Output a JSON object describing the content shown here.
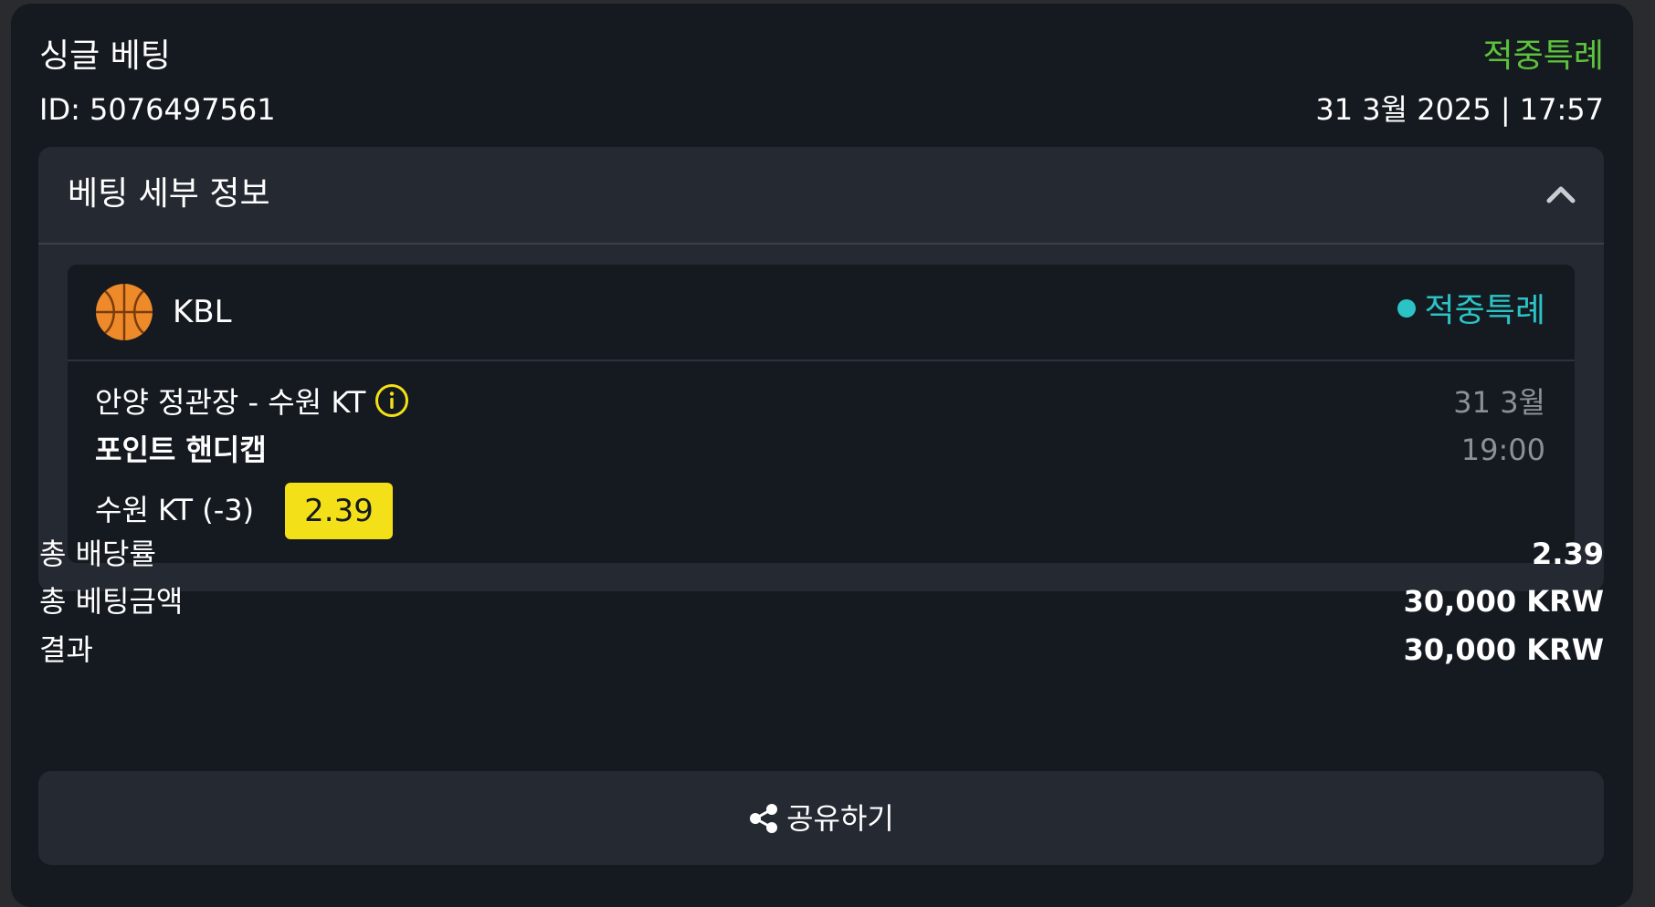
{
  "header": {
    "title": "싱글 베팅",
    "status": "적중특례",
    "id_text": "ID: 5076497561",
    "placed_at": "31 3월 2025 | 17:57"
  },
  "details": {
    "title": "베팅 세부 정보",
    "selection": {
      "league": "KBL",
      "status": "적중특례",
      "match": "안양 정관장 - 수원 KT",
      "date": "31 3월",
      "time": "19:00",
      "market": "포인트 핸디캡",
      "pick": "수원 KT (-3)",
      "odds": "2.39"
    }
  },
  "summary": [
    {
      "label": "총 배당률",
      "value": "2.39"
    },
    {
      "label": "총 베팅금액",
      "value": "30,000 KRW"
    },
    {
      "label": "결과",
      "value": "30,000 KRW"
    }
  ],
  "share": {
    "label": "공유하기"
  },
  "colors": {
    "card_bg": "#151a21",
    "panel_bg": "#252932",
    "status_green": "#5dc23c",
    "status_teal": "#2bc3c6",
    "odds_yellow": "#f4e018",
    "muted_text": "#8c9097"
  },
  "icons": {
    "collapse": "chevron-up-icon",
    "sport": "basketball-icon",
    "info": "info-icon",
    "share": "share-icon"
  }
}
